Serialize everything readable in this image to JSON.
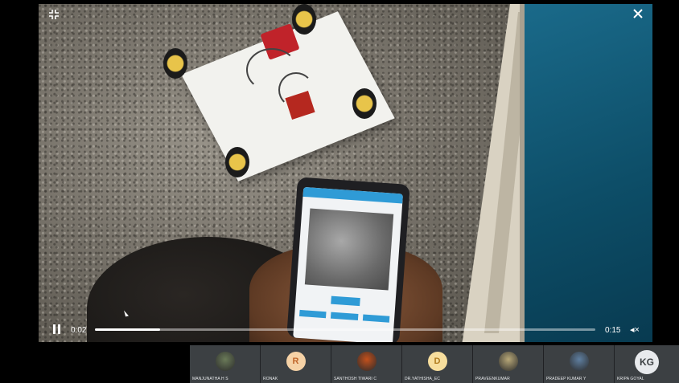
{
  "video": {
    "elapsed": "0:02",
    "duration": "0:15",
    "progress": 0.13,
    "state": "playing"
  },
  "icons": {
    "exit_fullscreen": "exit-fullscreen-icon",
    "close": "close-icon",
    "pause": "pause-icon",
    "mute": "volume-muted-icon"
  },
  "participants": [
    {
      "name": "MANJUNATHA H S",
      "avatar_type": "photo",
      "color": "#6a7a58"
    },
    {
      "name": "RONAK",
      "avatar_type": "initial",
      "initial": "R",
      "color": "#f6d2a6",
      "text_color": "#c0662a"
    },
    {
      "name": "SANTHOSH TIWARI C",
      "avatar_type": "photo",
      "color": "#c2501c"
    },
    {
      "name": "Dr.YATHISHA_EC",
      "avatar_type": "initial",
      "initial": "D",
      "color": "#f7de9d",
      "text_color": "#b07b1e"
    },
    {
      "name": "PRAVEENKUMAR",
      "avatar_type": "photo",
      "color": "#b8a878"
    },
    {
      "name": "PRADEEP KUMAR Y",
      "avatar_type": "photo",
      "color": "#5f7fa0"
    },
    {
      "name": "KRIPA GOYAL",
      "avatar_type": "initial",
      "initial": "KG",
      "color": "#e8eaed",
      "text_color": "#3c4043"
    }
  ]
}
